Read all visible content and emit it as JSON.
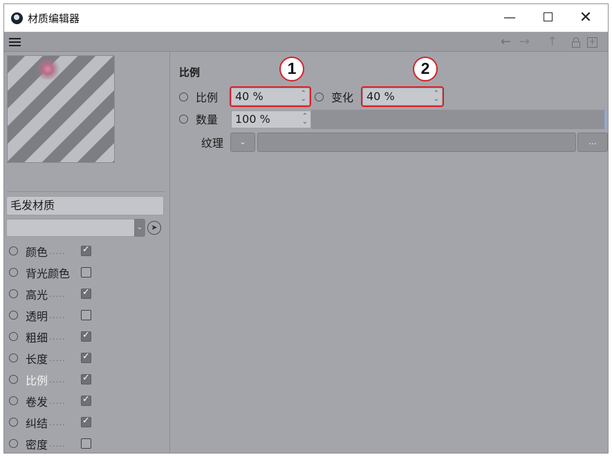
{
  "window": {
    "title": "材质编辑器",
    "minimize": "—",
    "close": "✕"
  },
  "toolbar": {
    "back_icon": "←",
    "forward_icon": "→",
    "up_icon": "↑",
    "new_icon": "+"
  },
  "left": {
    "material_name": "毛发材质",
    "channels": [
      {
        "label": "颜色",
        "dots": ".....",
        "checked": true
      },
      {
        "label": "背光颜色",
        "dots": "",
        "checked": false
      },
      {
        "label": "高光",
        "dots": ".....",
        "checked": true
      },
      {
        "label": "透明",
        "dots": ".....",
        "checked": false
      },
      {
        "label": "粗细",
        "dots": ".....",
        "checked": true
      },
      {
        "label": "长度",
        "dots": ".....",
        "checked": true
      },
      {
        "label": "比例",
        "dots": ".....",
        "checked": true,
        "active": true
      },
      {
        "label": "卷发",
        "dots": ".....",
        "checked": true
      },
      {
        "label": "纠结",
        "dots": ".....",
        "checked": true
      },
      {
        "label": "密度",
        "dots": ".....",
        "checked": false
      }
    ]
  },
  "right": {
    "section_title": "比例",
    "scale_label": "比例",
    "scale_value": "40 %",
    "variation_label": "变化",
    "variation_value": "40 %",
    "amount_label": "数量",
    "amount_value": "100 %",
    "amount_fraction": 1.0,
    "texture_label": "纹理",
    "texture_more": "..."
  },
  "markers": [
    "1",
    "2"
  ],
  "colors": {
    "panel_bg": "#a3a5aa",
    "highlight_red": "#d9202a",
    "slider_accent": "#8fa7d6"
  }
}
